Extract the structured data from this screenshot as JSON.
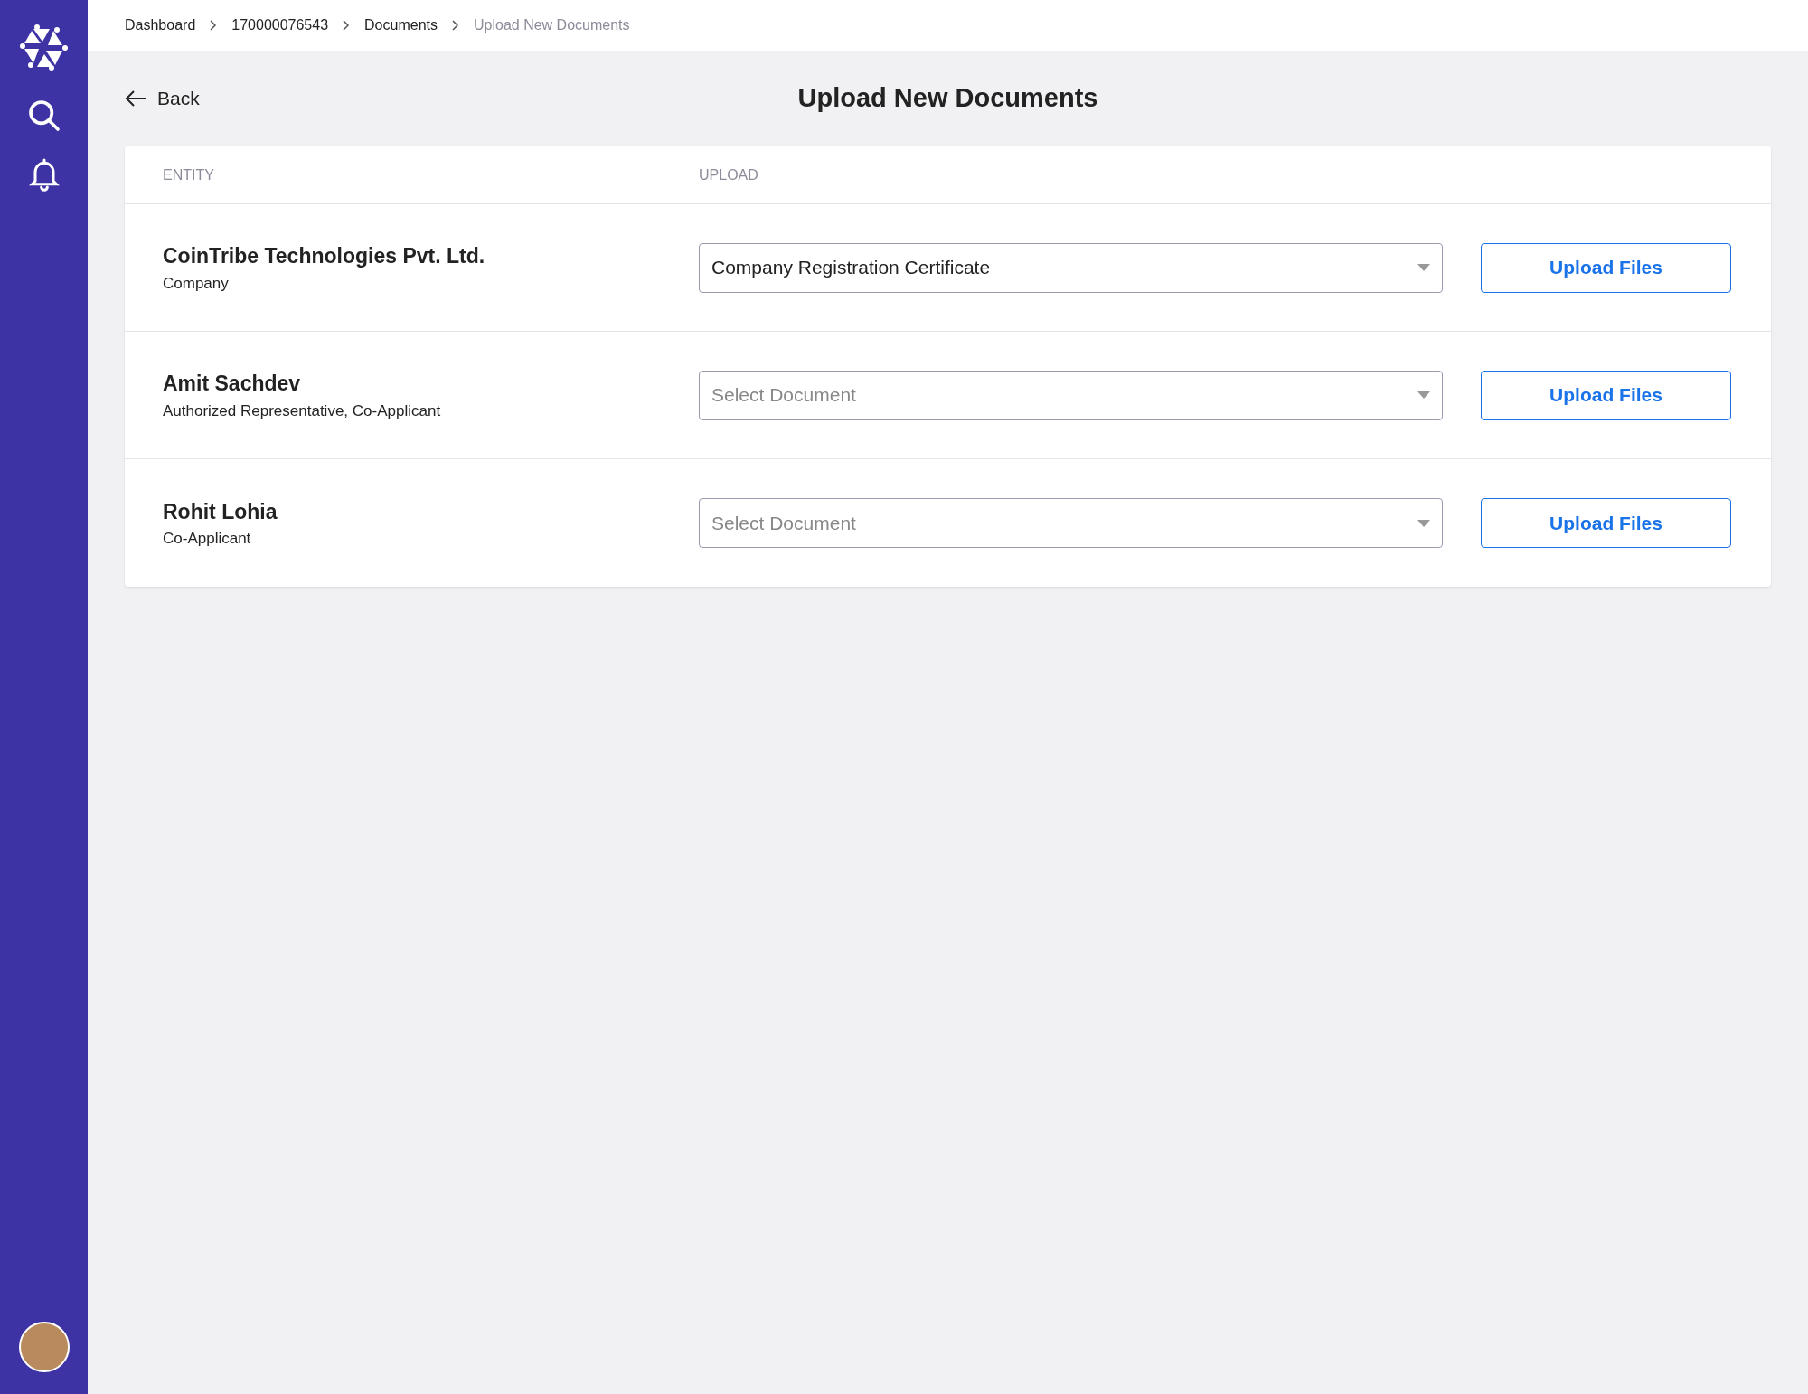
{
  "breadcrumbs": [
    {
      "label": "Dashboard",
      "current": false
    },
    {
      "label": "170000076543",
      "current": false
    },
    {
      "label": "Documents",
      "current": false
    },
    {
      "label": "Upload New Documents",
      "current": true
    }
  ],
  "back": {
    "label": "Back"
  },
  "title": "Upload New Documents",
  "table": {
    "columns": [
      "ENTITY",
      "UPLOAD"
    ],
    "rows": [
      {
        "name": "CoinTribe Technologies Pvt. Ltd.",
        "role": "Company",
        "select": {
          "value": "Company Registration Certificate"
        },
        "button": "Upload Files"
      },
      {
        "name": "Amit Sachdev",
        "role": "Authorized Representative, Co-Applicant",
        "select": {
          "placeholder": "Select Document"
        },
        "button": "Upload Files"
      },
      {
        "name": "Rohit Lohia",
        "role": "Co-Applicant",
        "select": {
          "placeholder": "Select Document"
        },
        "button": "Upload Files"
      }
    ]
  }
}
